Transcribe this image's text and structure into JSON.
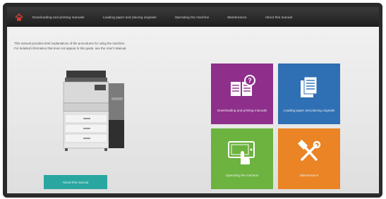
{
  "nav": {
    "items": [
      {
        "label": "Downloading and printing manuals"
      },
      {
        "label": "Loading paper and placing originals"
      },
      {
        "label": "Operating the machine"
      },
      {
        "label": "Maintenance"
      },
      {
        "label": "About this manual"
      }
    ],
    "home_icon": "home-icon"
  },
  "intro": {
    "line1": "This manual provides brief explanations of the procedures for using the machine.",
    "line2": "For detailed information that does not appear in this guide, see the User's Manual."
  },
  "about_button": {
    "label": "About this manual"
  },
  "tiles": [
    {
      "label": "Downloading and printing manuals",
      "icon": "book-question-icon",
      "color": "#8e2f8c"
    },
    {
      "label": "Loading paper and placing originals",
      "icon": "documents-icon",
      "color": "#2f6fb4"
    },
    {
      "label": "Operating the machine",
      "icon": "touch-panel-icon",
      "color": "#6db33f"
    },
    {
      "label": "Maintenance",
      "icon": "tools-icon",
      "color": "#ea8424"
    }
  ],
  "colors": {
    "nav_bg": "#1f1f1f",
    "accent_teal": "#2aa6a0"
  }
}
